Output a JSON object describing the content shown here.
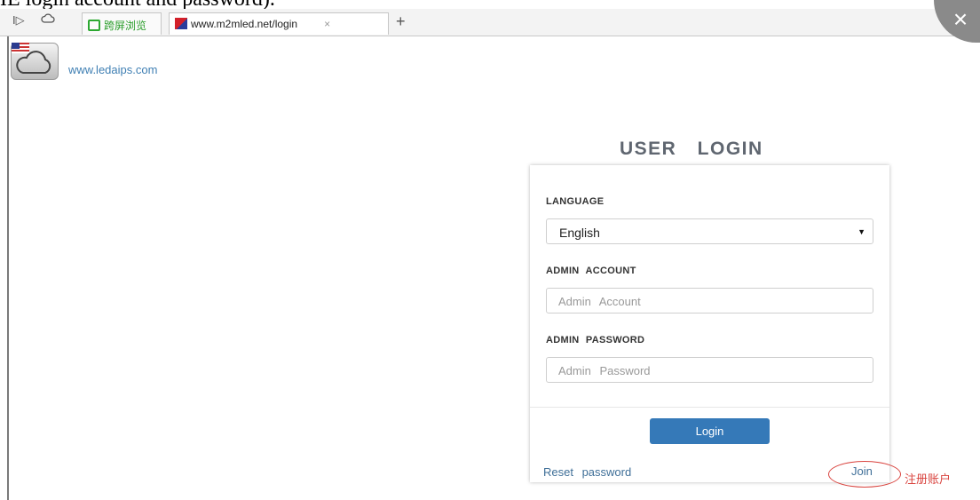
{
  "document": {
    "caption_fragment": "IE login account and password)."
  },
  "browser": {
    "nav_icons": [
      "forward-icon",
      "cloud-icon"
    ],
    "tabs": [
      {
        "label": "跨屏浏览",
        "icon": "phone-icon"
      },
      {
        "label": "www.m2mled.net/login",
        "icon": "site-favicon",
        "close": "×"
      }
    ],
    "new_tab": "+",
    "window_close": "×"
  },
  "page": {
    "site_link": "www.ledaips.com",
    "title": "USER LOGIN",
    "form": {
      "language_label": "LANGUAGE",
      "language_value": "English",
      "account_label": "ADMIN ACCOUNT",
      "account_placeholder": "Admin Account",
      "password_label": "ADMIN PASSWORD",
      "password_placeholder": "Admin Password",
      "login_button": "Login",
      "reset_link": "Reset password",
      "join_link": "Join"
    }
  },
  "annotation": {
    "text": "注册账户",
    "color": "#d9443f"
  },
  "colors": {
    "button": "#3579b8",
    "link": "#3f6f98",
    "title": "#5f6670"
  }
}
